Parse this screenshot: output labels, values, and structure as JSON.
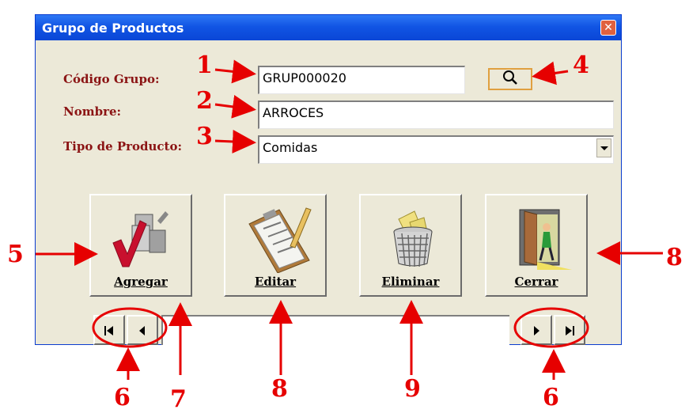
{
  "window": {
    "title": "Grupo de Productos",
    "close_glyph": "✕"
  },
  "form": {
    "codigo_label": "Código Grupo:",
    "codigo_value": "GRUP000020",
    "nombre_label": "Nombre:",
    "nombre_value": "ARROCES",
    "tipo_label": "Tipo de Producto:",
    "tipo_value": "Comidas"
  },
  "actions": {
    "agregar": "Agregar",
    "editar": "Editar",
    "eliminar": "Eliminar",
    "cerrar": "Cerrar"
  },
  "icons": {
    "search": "magnifier-icon",
    "agregar": "add-checkmark-icon",
    "editar": "clipboard-pencil-icon",
    "eliminar": "trash-basket-icon",
    "cerrar": "exit-door-icon",
    "nav_first": "first-record-icon",
    "nav_prev": "previous-record-icon",
    "nav_next": "next-record-icon",
    "nav_last": "last-record-icon"
  },
  "annotations": {
    "n1": "1",
    "n2": "2",
    "n3": "3",
    "n4": "4",
    "n5": "5",
    "n6a": "6",
    "n6b": "6",
    "n7": "7",
    "n8a": "8",
    "n8b": "8",
    "n9": "9"
  },
  "colors": {
    "label": "#8b1414",
    "annotation": "#e60000",
    "titlebar": "#0a46d6",
    "window_bg": "#ece9d8"
  }
}
